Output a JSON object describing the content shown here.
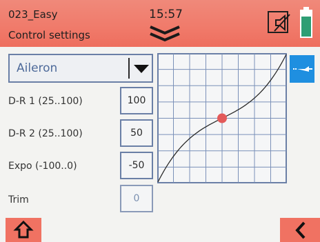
{
  "header": {
    "model_name": "023_Easy",
    "screen_title": "Control settings",
    "time": "15:57",
    "sound_icon": "speaker-muted-icon",
    "battery_icon": "battery-icon"
  },
  "control": {
    "selected": "Aileron"
  },
  "params": [
    {
      "label": "D-R 1 (25..100)",
      "value": "100"
    },
    {
      "label": "D-R 2 (25..100)",
      "value": "50"
    },
    {
      "label": "Expo (-100..0)",
      "value": "-50"
    },
    {
      "label": "Trim",
      "value": "0"
    }
  ],
  "graph": {
    "grid_cols": 8,
    "grid_rows": 8,
    "curve_color": "#2a2a2a",
    "point_color": "#e35a5a"
  },
  "colors": {
    "header": "#f07a6a",
    "accent_blue": "#1f8fe0",
    "button_red": "#f07262"
  },
  "icons": {
    "home": "home-icon",
    "back": "back-arrow-icon",
    "edit": "curve-edit-icon",
    "chevrons": "double-chevron-down-icon",
    "select_arrow": "triangle-down-icon"
  }
}
